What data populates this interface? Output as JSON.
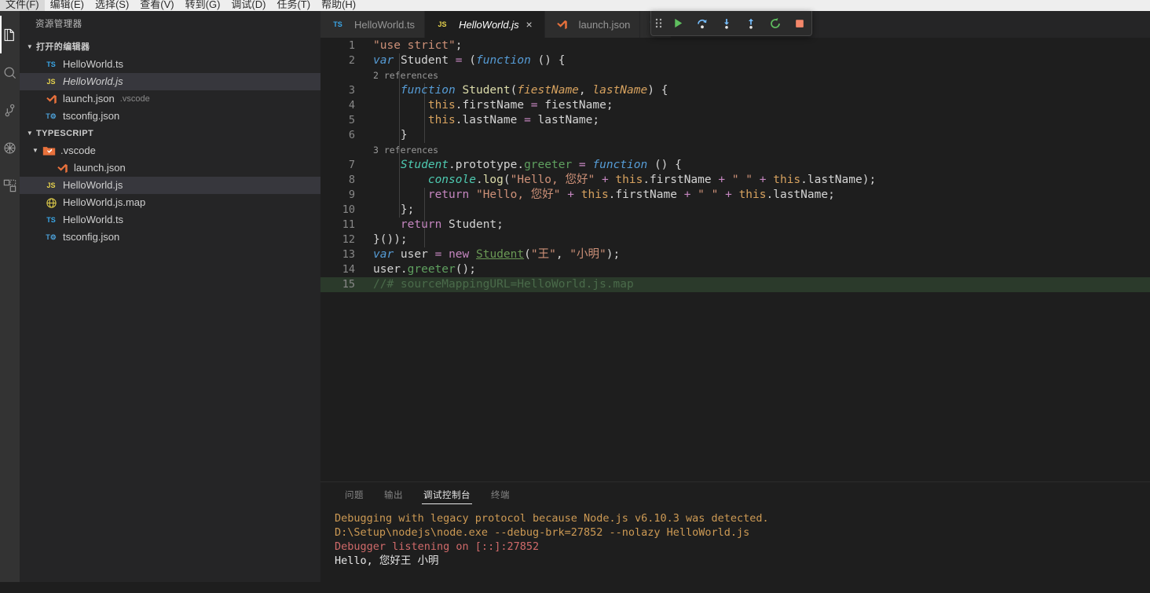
{
  "menubar": {
    "items": [
      "文件(F)",
      "编辑(E)",
      "选择(S)",
      "查看(V)",
      "转到(G)",
      "调试(D)",
      "任务(T)",
      "帮助(H)"
    ]
  },
  "activitybar": {
    "items": [
      {
        "name": "explorer-icon",
        "label": "资源管理器",
        "active": true
      },
      {
        "name": "search-icon",
        "label": "搜索",
        "active": false
      },
      {
        "name": "source-control-icon",
        "label": "源代码管理",
        "active": false
      },
      {
        "name": "debug-icon",
        "label": "调试",
        "active": false
      },
      {
        "name": "extensions-icon",
        "label": "扩展",
        "active": false
      }
    ]
  },
  "sidebar": {
    "title": "资源管理器",
    "sections": [
      {
        "label": "打开的编辑器",
        "expanded": true,
        "items": [
          {
            "icon": "ts-file-icon",
            "name": "HelloWorld.ts",
            "sub": "",
            "italic": false,
            "selected": false,
            "indent": 1
          },
          {
            "icon": "js-file-icon",
            "name": "HelloWorld.js",
            "sub": "",
            "italic": true,
            "selected": true,
            "indent": 1
          },
          {
            "icon": "vscode-file-icon",
            "name": "launch.json",
            "sub": ".vscode",
            "italic": false,
            "selected": false,
            "indent": 1
          },
          {
            "icon": "tsconfig-file-icon",
            "name": "tsconfig.json",
            "sub": "",
            "italic": false,
            "selected": false,
            "indent": 1
          }
        ]
      },
      {
        "label": "TYPESCRIPT",
        "expanded": true,
        "items": [
          {
            "icon": "vscode-folder-icon",
            "name": ".vscode",
            "sub": "",
            "italic": false,
            "selected": false,
            "indent": 1,
            "folder": true
          },
          {
            "icon": "vscode-file-icon",
            "name": "launch.json",
            "sub": "",
            "italic": false,
            "selected": false,
            "indent": 2
          },
          {
            "icon": "js-file-icon",
            "name": "HelloWorld.js",
            "sub": "",
            "italic": false,
            "selected": true,
            "indent": 1
          },
          {
            "icon": "map-file-icon",
            "name": "HelloWorld.js.map",
            "sub": "",
            "italic": false,
            "selected": false,
            "indent": 1
          },
          {
            "icon": "ts-file-icon",
            "name": "HelloWorld.ts",
            "sub": "",
            "italic": false,
            "selected": false,
            "indent": 1
          },
          {
            "icon": "tsconfig-file-icon",
            "name": "tsconfig.json",
            "sub": "",
            "italic": false,
            "selected": false,
            "indent": 1
          }
        ]
      }
    ]
  },
  "tabs": [
    {
      "icon": "ts-file-icon",
      "label": "HelloWorld.ts",
      "active": false,
      "italic": false,
      "close": false
    },
    {
      "icon": "js-file-icon",
      "label": "HelloWorld.js",
      "active": true,
      "italic": true,
      "close": true,
      "close_label": "×"
    },
    {
      "icon": "vscode-file-icon",
      "label": "launch.json",
      "active": false,
      "italic": false,
      "close": false
    },
    {
      "icon": "ts-file-icon",
      "label": "",
      "active": false,
      "italic": false,
      "close": false
    }
  ],
  "debug_toolbar": {
    "buttons": [
      {
        "name": "drag-handle-icon",
        "label": "拖动"
      },
      {
        "name": "continue-icon",
        "label": "继续 (F5)"
      },
      {
        "name": "step-over-icon",
        "label": "单步跳过 (F10)"
      },
      {
        "name": "step-into-icon",
        "label": "单步调试 (F11)"
      },
      {
        "name": "step-out-icon",
        "label": "单步跳出 (Shift+F11)"
      },
      {
        "name": "restart-icon",
        "label": "重启 (Ctrl+Shift+F5)"
      },
      {
        "name": "stop-icon",
        "label": "停止 (Shift+F5)"
      }
    ]
  },
  "code": {
    "codelens": [
      {
        "after_line": 2,
        "text": "2 references",
        "indent": 8
      },
      {
        "after_line": 6,
        "text": "3 references",
        "indent": 8
      }
    ],
    "lines": [
      {
        "n": 1,
        "text": "\"use strict\";"
      },
      {
        "n": 2,
        "text": "var Student = (function () {"
      },
      {
        "n": 3,
        "text": "    function Student(fiestName, lastName) {"
      },
      {
        "n": 4,
        "text": "        this.firstName = fiestName;"
      },
      {
        "n": 5,
        "text": "        this.lastName = lastName;"
      },
      {
        "n": 6,
        "text": "    }"
      },
      {
        "n": 7,
        "text": "    Student.prototype.greeter = function () {"
      },
      {
        "n": 8,
        "text": "        console.log(\"Hello, 您好\" + this.firstName + \" \" + this.lastName);"
      },
      {
        "n": 9,
        "text": "        return \"Hello, 您好\" + this.firstName + \" \" + this.lastName;"
      },
      {
        "n": 10,
        "text": "    };"
      },
      {
        "n": 11,
        "text": "    return Student;"
      },
      {
        "n": 12,
        "text": "}());"
      },
      {
        "n": 13,
        "text": "var user = new Student(\"王\", \"小明\");"
      },
      {
        "n": 14,
        "text": "user.greeter();"
      },
      {
        "n": 15,
        "text": "//# sourceMappingURL=HelloWorld.js.map",
        "current": true
      }
    ]
  },
  "panel": {
    "tabs": [
      {
        "label": "问题",
        "active": false
      },
      {
        "label": "输出",
        "active": false
      },
      {
        "label": "调试控制台",
        "active": true
      },
      {
        "label": "终端",
        "active": false
      }
    ],
    "console_lines": [
      {
        "text": "Debugging with legacy protocol because Node.js v6.10.3 was detected.",
        "type": "warn"
      },
      {
        "text": "D:\\Setup\\nodejs\\node.exe --debug-brk=27852 --nolazy HelloWorld.js",
        "type": "warn"
      },
      {
        "text": "Debugger listening on [::]:27852",
        "type": "err"
      },
      {
        "text": "Hello, 您好王 小明",
        "type": "out"
      }
    ]
  },
  "colors": {
    "background": "#1e1e1e",
    "sidebar_bg": "#252526",
    "activitybar_bg": "#333333",
    "current_line": "#2b3a2b",
    "selection": "#37373d",
    "accent_green": "#89d185",
    "accent_blue": "#75beff",
    "stop_red": "#f48771"
  }
}
